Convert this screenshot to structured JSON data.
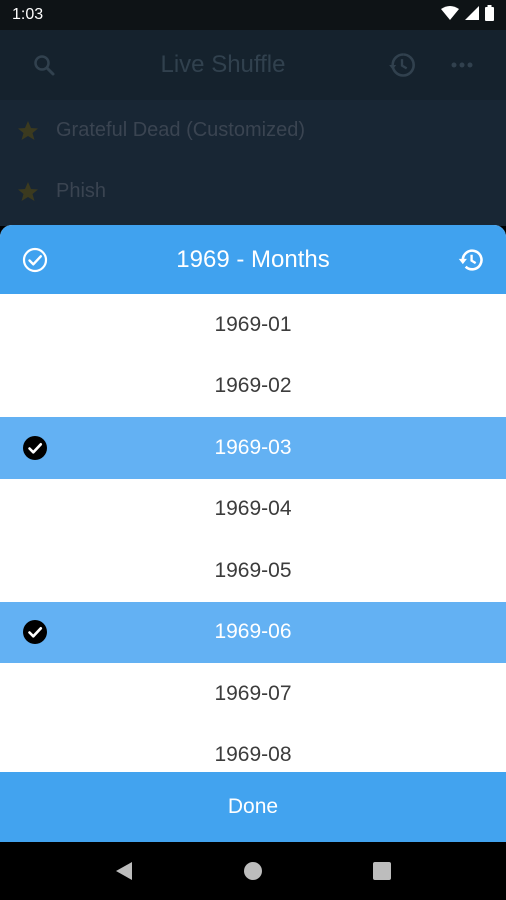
{
  "status_bar": {
    "time": "1:03"
  },
  "app_bar": {
    "title": "Live Shuffle"
  },
  "background_list": [
    {
      "label": "Grateful Dead (Customized)"
    },
    {
      "label": "Phish"
    }
  ],
  "dialog": {
    "title": "1969 - Months",
    "months": [
      {
        "label": "1969-01",
        "selected": false
      },
      {
        "label": "1969-02",
        "selected": false
      },
      {
        "label": "1969-03",
        "selected": true
      },
      {
        "label": "1969-04",
        "selected": false
      },
      {
        "label": "1969-05",
        "selected": false
      },
      {
        "label": "1969-06",
        "selected": true
      },
      {
        "label": "1969-07",
        "selected": false
      },
      {
        "label": "1969-08",
        "selected": false
      }
    ],
    "done_label": "Done"
  },
  "colors": {
    "header_blue": "#40a2ef",
    "selected_row": "#63b1f3",
    "app_bar_bg": "#15222d",
    "star": "#3b3a1f"
  },
  "icons": {
    "status": [
      "wifi-icon",
      "signal-icon",
      "battery-icon"
    ],
    "app_bar": [
      "search-icon",
      "history-icon",
      "more-icon"
    ],
    "dialog": [
      "select-all-icon",
      "history-icon"
    ],
    "nav": [
      "back-icon",
      "home-icon",
      "recents-icon"
    ]
  }
}
